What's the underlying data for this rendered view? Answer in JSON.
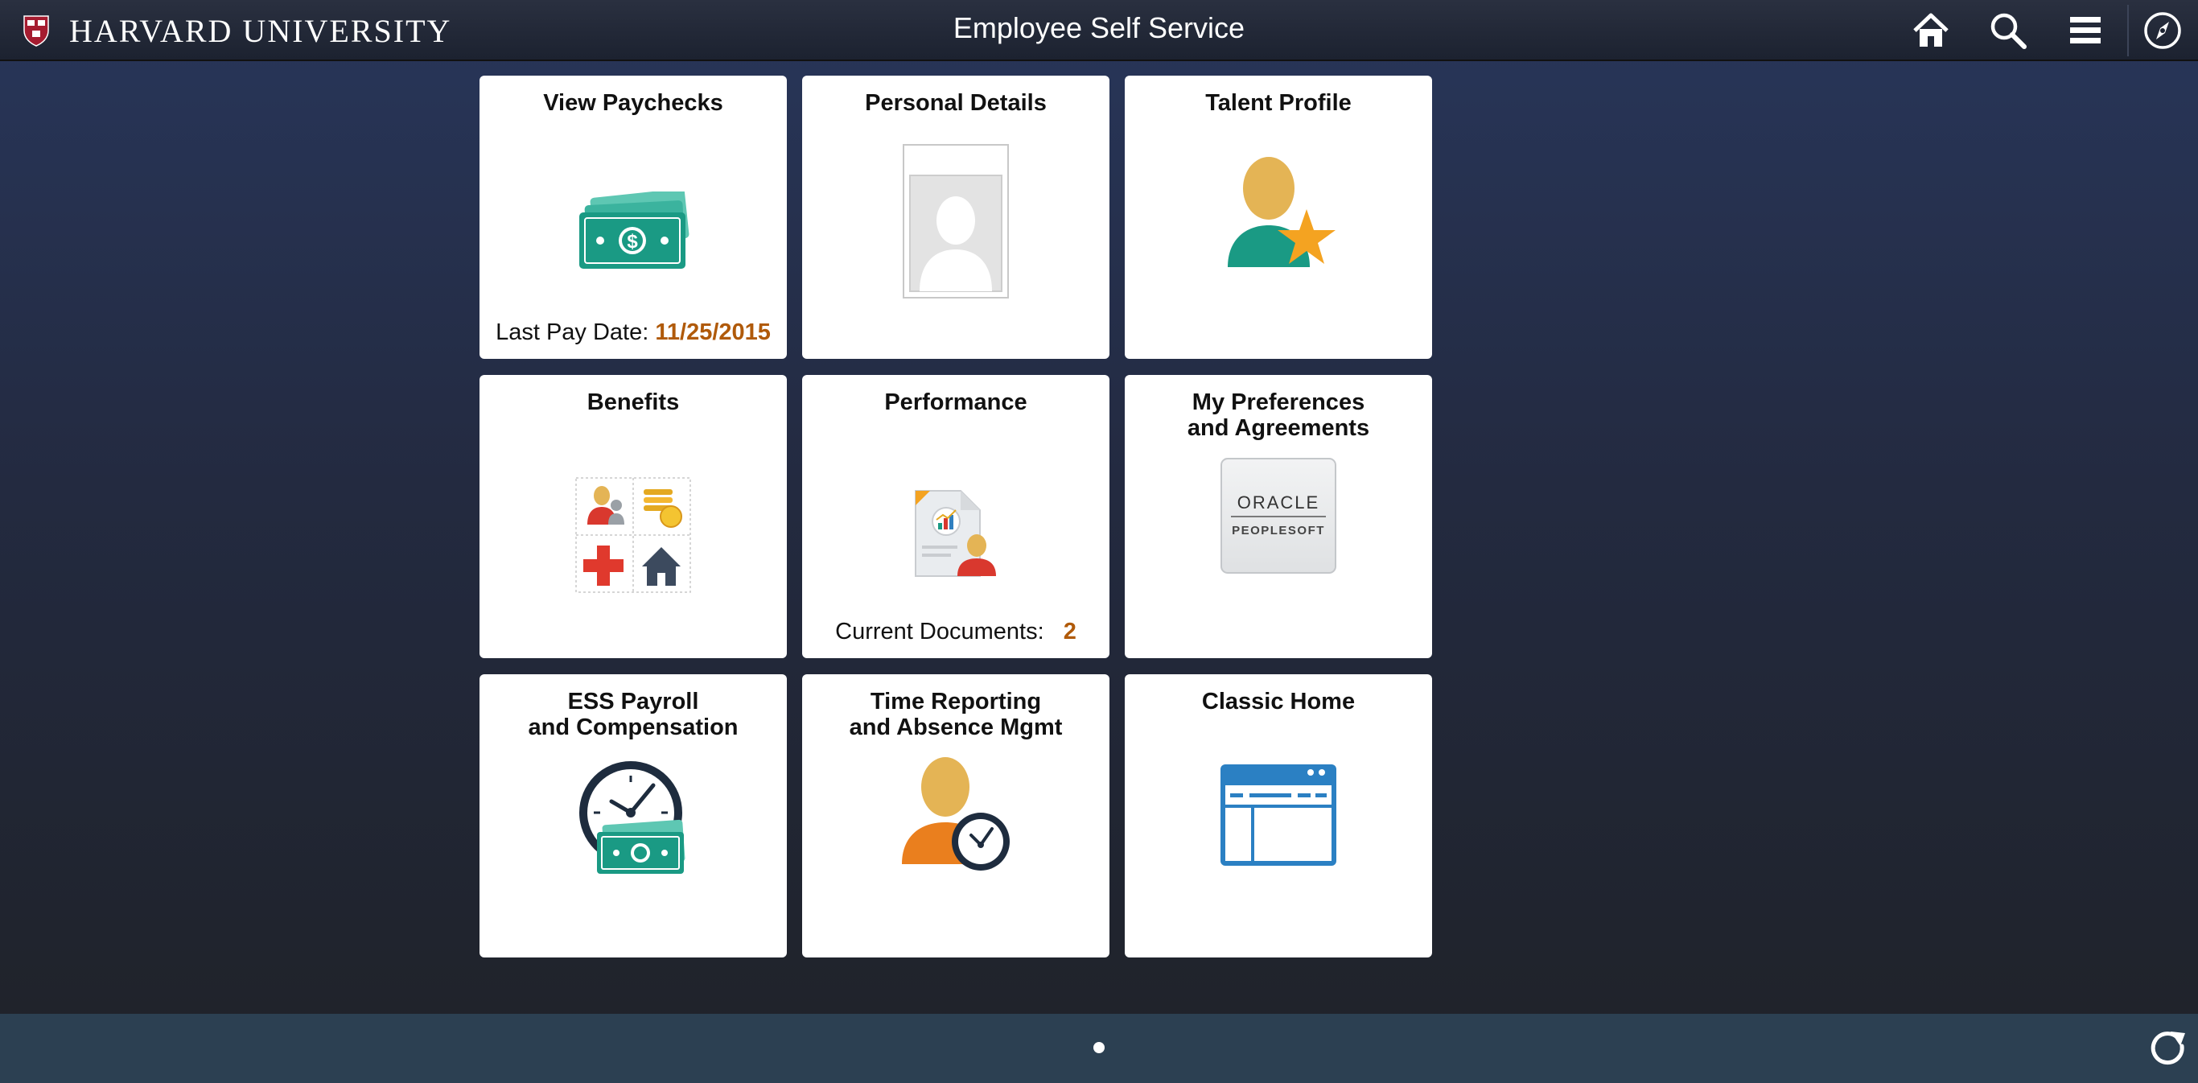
{
  "header": {
    "brand": "HARVARD UNIVERSITY",
    "title": "Employee Self Service",
    "icons": [
      "home-icon",
      "search-icon",
      "menu-icon",
      "navbar-compass-icon"
    ]
  },
  "tiles": [
    {
      "title": "View Paychecks",
      "icon": "money-icon",
      "footer_label": "Last Pay Date:",
      "footer_value": "11/25/2015"
    },
    {
      "title": "Personal Details",
      "icon": "person-photo-icon"
    },
    {
      "title": "Talent Profile",
      "icon": "person-star-icon"
    },
    {
      "title": "Benefits",
      "icon": "benefits-icon"
    },
    {
      "title": "Performance",
      "icon": "performance-document-icon",
      "footer_label": "Current Documents:",
      "footer_value": "2"
    },
    {
      "title": "My Preferences\nand Agreements",
      "icon": "oracle-peoplesoft-logo",
      "logo_line1": "ORACLE",
      "logo_line2": "PEOPLESOFT"
    },
    {
      "title": "ESS Payroll\nand Compensation",
      "icon": "clock-money-icon"
    },
    {
      "title": "Time Reporting\nand Absence Mgmt",
      "icon": "person-clock-icon"
    },
    {
      "title": "Classic Home",
      "icon": "browser-window-icon"
    }
  ],
  "bottom_bar": {
    "page_indicator_icon": "page-dot",
    "refresh_icon": "refresh-icon"
  },
  "colors": {
    "accent": "#b05a0a",
    "teal": "#1a9a84",
    "tile_bg": "#ffffff",
    "bottom_bar": "#2c4052"
  }
}
